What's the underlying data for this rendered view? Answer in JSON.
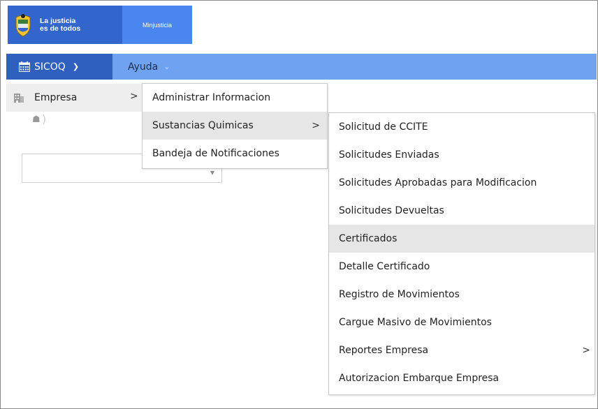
{
  "header": {
    "slogan_line1": "La justicia",
    "slogan_line2": "es de todos",
    "ministry": "Minjusticia"
  },
  "navbar": {
    "sicoq_label": "SICOQ",
    "ayuda_label": "Ayuda"
  },
  "menu_level1": {
    "items": [
      {
        "label": "Empresa",
        "icon": "building-icon",
        "has_submenu": true
      }
    ]
  },
  "menu_level2": {
    "items": [
      {
        "label": "Administrar Informacion"
      },
      {
        "label": "Sustancias Quimicas",
        "has_submenu": true,
        "active": true
      },
      {
        "label": "Bandeja de Notificaciones"
      }
    ]
  },
  "menu_level3": {
    "items": [
      {
        "label": "Solicitud de CCITE"
      },
      {
        "label": "Solicitudes Enviadas"
      },
      {
        "label": "Solicitudes Aprobadas para Modificacion"
      },
      {
        "label": "Solicitudes Devueltas"
      },
      {
        "label": "Certificados",
        "hovered": true
      },
      {
        "label": "Detalle Certificado"
      },
      {
        "label": "Registro de Movimientos"
      },
      {
        "label": "Cargue Masivo de Movimientos"
      },
      {
        "label": "Reportes Empresa",
        "has_submenu": true
      },
      {
        "label": "Autorizacion Embarque Empresa"
      }
    ]
  },
  "colors": {
    "brand_dark_blue": "#2f5fbf",
    "navbar_blue": "#6fa3f1",
    "logo_blue": "#3366cc",
    "ministry_blue": "#4a86f0",
    "menu_highlight": "#e6e6e6"
  }
}
